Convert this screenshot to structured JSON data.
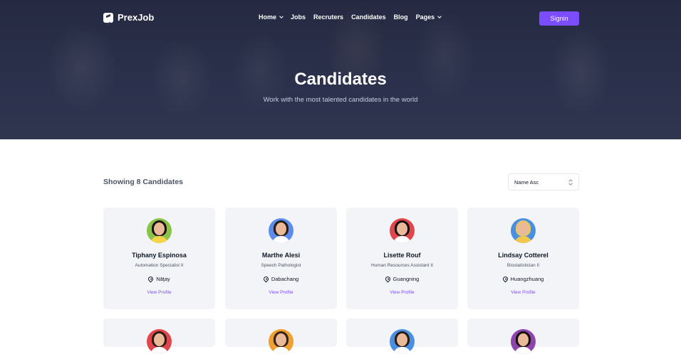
{
  "brand": {
    "name": "PrexJob"
  },
  "nav": {
    "items": [
      {
        "label": "Home",
        "dropdown": true
      },
      {
        "label": "Jobs",
        "dropdown": false
      },
      {
        "label": "Recruters",
        "dropdown": false
      },
      {
        "label": "Candidates",
        "dropdown": false
      },
      {
        "label": "Blog",
        "dropdown": false
      },
      {
        "label": "Pages",
        "dropdown": true
      }
    ],
    "signin_label": "Signin"
  },
  "hero": {
    "title": "Candidates",
    "subtitle": "Work with the most talented candidates in the world"
  },
  "listing": {
    "showing": "Showing 8 Candidates",
    "sort_value": "Name Asc"
  },
  "candidates": [
    {
      "name": "Tiphany Espinosa",
      "role": "Automation Specialist II",
      "location": "Nāţay",
      "action": "View Profile",
      "avatar_bg": "#8bc34a",
      "hair": "#1c1412",
      "shirt": "#f5d547"
    },
    {
      "name": "Marthe Alesi",
      "role": "Speech Pathologist",
      "location": "Dabachang",
      "action": "View Profile",
      "avatar_bg": "#5b8def",
      "hair": "#2b1d16",
      "shirt": "#ffffff"
    },
    {
      "name": "Lisette Rouf",
      "role": "Human Resources Assistant II",
      "location": "Guangning",
      "action": "View Profile",
      "avatar_bg": "#e0474c",
      "hair": "#1a0f0c",
      "shirt": "#ffffff"
    },
    {
      "name": "Lindsay Cotterel",
      "role": "Biostatistician II",
      "location": "Huangzhuang",
      "action": "View Profile",
      "avatar_bg": "#4a90e2",
      "hair": "#e8c46a",
      "shirt": "#f3c74a"
    },
    {
      "avatar_bg": "#e0474c",
      "hair": "#2b1d16",
      "shirt": "#ffffff"
    },
    {
      "avatar_bg": "#f0a030",
      "hair": "#3a2418",
      "shirt": "#ffffff"
    },
    {
      "avatar_bg": "#4a90e2",
      "hair": "#2b1d16",
      "shirt": "#ffffff"
    },
    {
      "avatar_bg": "#8e44ad",
      "hair": "#1a0f0c",
      "shirt": "#ffffff"
    }
  ]
}
